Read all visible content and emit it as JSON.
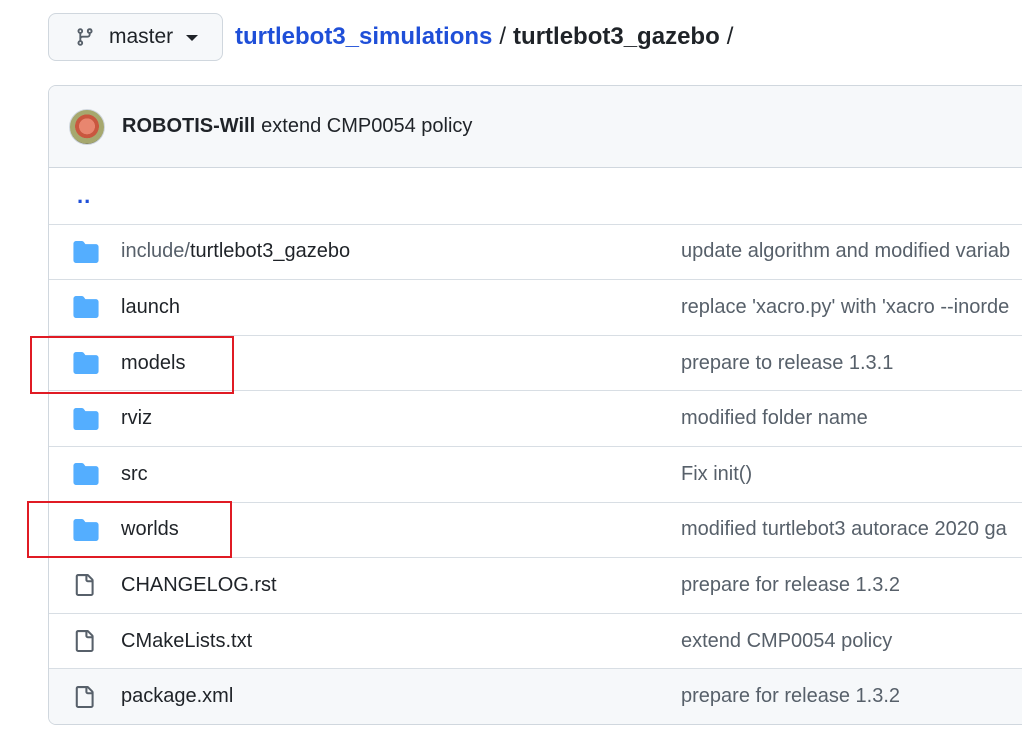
{
  "branch": {
    "label": "master",
    "icon": "git-branch-icon"
  },
  "breadcrumb": {
    "repo": "turtlebot3_simulations",
    "sep1": "/",
    "current": "turtlebot3_gazebo",
    "sep2": "/"
  },
  "commit": {
    "author": "ROBOTIS-Will",
    "message": "extend CMP0054 policy"
  },
  "parent_link": "..",
  "rows": [
    {
      "type": "folder",
      "prefix": "include/",
      "name": "turtlebot3_gazebo",
      "message": "update algorithm and modified variab"
    },
    {
      "type": "folder",
      "prefix": "",
      "name": "launch",
      "message": "replace 'xacro.py' with 'xacro --inorde"
    },
    {
      "type": "folder",
      "prefix": "",
      "name": "models",
      "message": "prepare to release 1.3.1"
    },
    {
      "type": "folder",
      "prefix": "",
      "name": "rviz",
      "message": "modified folder name"
    },
    {
      "type": "folder",
      "prefix": "",
      "name": "src",
      "message": "Fix init()"
    },
    {
      "type": "folder",
      "prefix": "",
      "name": "worlds",
      "message": "modified turtlebot3 autorace 2020 ga"
    },
    {
      "type": "file",
      "prefix": "",
      "name": "CHANGELOG.rst",
      "message": "prepare for release 1.3.2"
    },
    {
      "type": "file",
      "prefix": "",
      "name": "CMakeLists.txt",
      "message": "extend CMP0054 policy"
    },
    {
      "type": "file",
      "prefix": "",
      "name": "package.xml",
      "message": "prepare for release 1.3.2"
    }
  ],
  "colors": {
    "link": "#1f4fd8",
    "folder_icon": "#54aeff",
    "highlight": "#e01b24"
  }
}
